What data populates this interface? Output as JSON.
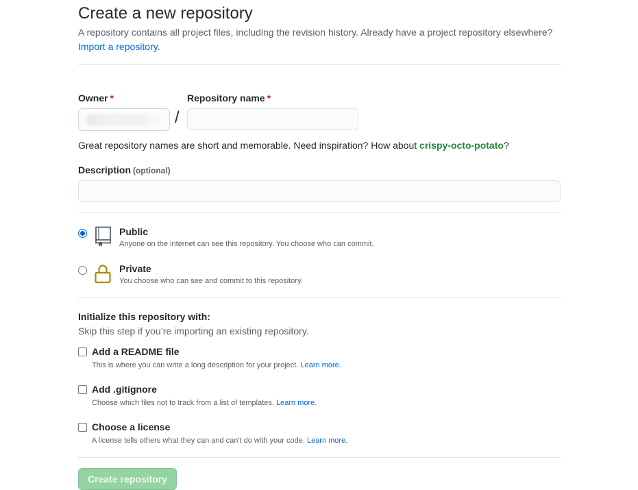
{
  "header": {
    "title": "Create a new repository",
    "subtitle": "A repository contains all project files, including the revision history. Already have a project repository elsewhere?",
    "import_link": "Import a repository."
  },
  "owner": {
    "label": "Owner",
    "required_mark": "*",
    "separator": "/"
  },
  "repo_name": {
    "label": "Repository name",
    "required_mark": "*",
    "value": "",
    "hint_prefix": "Great repository names are short and memorable. Need inspiration? How about ",
    "suggestion": "crispy-octo-potato",
    "hint_suffix": "?"
  },
  "description": {
    "label": "Description",
    "optional": "(optional)",
    "value": ""
  },
  "visibility": {
    "selected": "public",
    "options": [
      {
        "title": "Public",
        "desc": "Anyone on the internet can see this repository. You choose who can commit.",
        "icon": "repo-icon"
      },
      {
        "title": "Private",
        "desc": "You choose who can see and commit to this repository.",
        "icon": "lock-icon"
      }
    ]
  },
  "init": {
    "title": "Initialize this repository with:",
    "subtitle": "Skip this step if you’re importing an existing repository.",
    "options": [
      {
        "title": "Add a README file",
        "desc": "This is where you can write a long description for your project.",
        "link": "Learn more.",
        "checked": false
      },
      {
        "title": "Add .gitignore",
        "desc": "Choose which files not to track from a list of templates.",
        "link": "Learn more.",
        "checked": false
      },
      {
        "title": "Choose a license",
        "desc": "A license tells others what they can and can't do with your code.",
        "link": "Learn more.",
        "checked": false
      }
    ]
  },
  "submit": {
    "label": "Create repository",
    "disabled": true
  },
  "colors": {
    "link": "#0366d6",
    "required": "#cb2431",
    "suggestion": "#22863a",
    "button_disabled": "#94d3a2",
    "lock_icon": "#b08800"
  }
}
